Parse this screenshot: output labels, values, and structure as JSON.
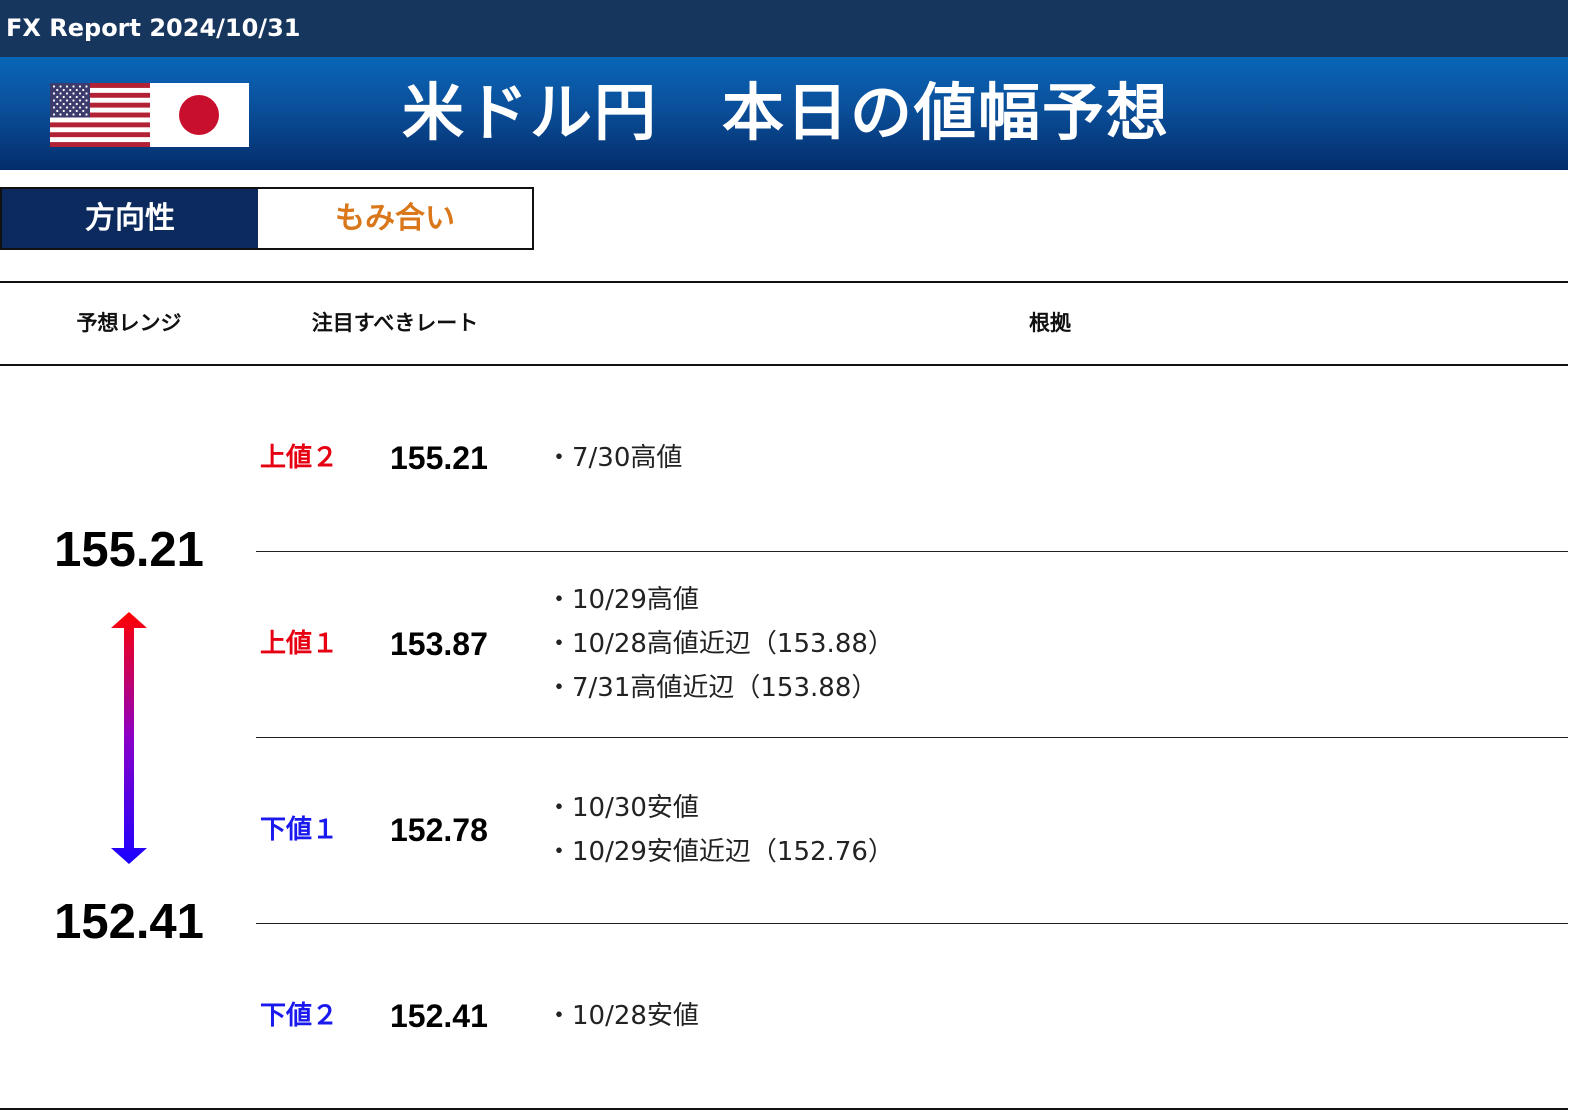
{
  "header": {
    "report_title": "FX Report 2024/10/31",
    "main_title": "米ドル円　本日の値幅予想"
  },
  "direction": {
    "label": "方向性",
    "value": "もみ合い",
    "value_color": "#d9771a"
  },
  "columns": {
    "range": "予想レンジ",
    "rate": "注目すべきレート",
    "basis": "根拠"
  },
  "range": {
    "high": "155.21",
    "low": "152.41"
  },
  "levels": [
    {
      "label": "上値２",
      "rate": "155.21",
      "color": "#e60012",
      "reasons": [
        "・7/30高値"
      ]
    },
    {
      "label": "上値１",
      "rate": "153.87",
      "color": "#e60012",
      "reasons": [
        "・10/29高値",
        "・10/28高値近辺（153.88）",
        "・7/31高値近辺（153.88）"
      ]
    },
    {
      "label": "下値１",
      "rate": "152.78",
      "color": "#1a1aee",
      "reasons": [
        "・10/30安値",
        "・10/29安値近辺（152.76）"
      ]
    },
    {
      "label": "下値２",
      "rate": "152.41",
      "color": "#1a1aee",
      "reasons": [
        "・10/28安値"
      ]
    }
  ],
  "icons": {
    "us_flag": "us-flag-icon",
    "jp_flag": "japan-flag-icon",
    "range_arrow": "double-arrow-icon"
  }
}
